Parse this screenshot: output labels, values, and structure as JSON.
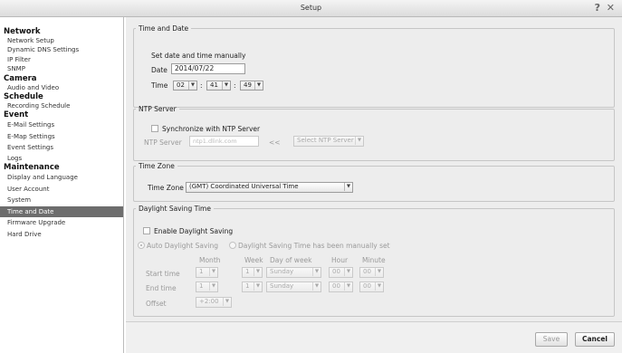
{
  "window": {
    "title": "Setup",
    "help_icon": "?",
    "close_icon": "✕"
  },
  "sidebar": {
    "groups": [
      {
        "title": "Network",
        "items": [
          "Network Setup",
          "Dynamic DNS Settings",
          "IP Filter",
          "SNMP"
        ]
      },
      {
        "title": "Camera",
        "items": [
          "Audio and Video"
        ]
      },
      {
        "title": "Schedule",
        "items": [
          "Recording Schedule"
        ]
      },
      {
        "title": "Event",
        "items": [
          "E-Mail Settings",
          "E-Map Settings",
          "Event Settings",
          "Logs"
        ]
      },
      {
        "title": "Maintenance",
        "items": [
          "Display and Language",
          "User Account",
          "System",
          "Time and Date",
          "Firmware Upgrade",
          "Hard Drive"
        ]
      }
    ],
    "selected": "Time and Date"
  },
  "time_date": {
    "legend": "Time and Date",
    "manual_label": "Set date and time manually",
    "date_label": "Date",
    "date_value": "2014/07/22",
    "time_label": "Time",
    "hour": "02",
    "minute": "41",
    "second": "49",
    "sep": ":"
  },
  "ntp": {
    "legend": "NTP Server",
    "sync_label": "Synchronize with NTP Server",
    "server_label": "NTP Server",
    "server_placeholder": "ntp1.dlink.com",
    "arrows": "<<",
    "select_label": "Select NTP Server"
  },
  "timezone": {
    "legend": "Time Zone",
    "label": "Time Zone",
    "value": "(GMT) Coordinated Universal Time"
  },
  "dst": {
    "legend": "Daylight Saving Time",
    "enable_label": "Enable Daylight Saving",
    "auto_label": "Auto Daylight Saving",
    "manual_label": "Daylight Saving Time has been manually set",
    "columns": [
      "Month",
      "Week",
      "Day of week",
      "Hour",
      "Minute"
    ],
    "start_label": "Start time",
    "end_label": "End time",
    "offset_label": "Offset",
    "start": {
      "month": "1",
      "week": "1",
      "day": "Sunday",
      "hour": "00",
      "minute": "00"
    },
    "end": {
      "month": "1",
      "week": "1",
      "day": "Sunday",
      "hour": "00",
      "minute": "00"
    },
    "offset": "+2:00"
  },
  "footer": {
    "save_label": "Save",
    "cancel_label": "Cancel"
  }
}
